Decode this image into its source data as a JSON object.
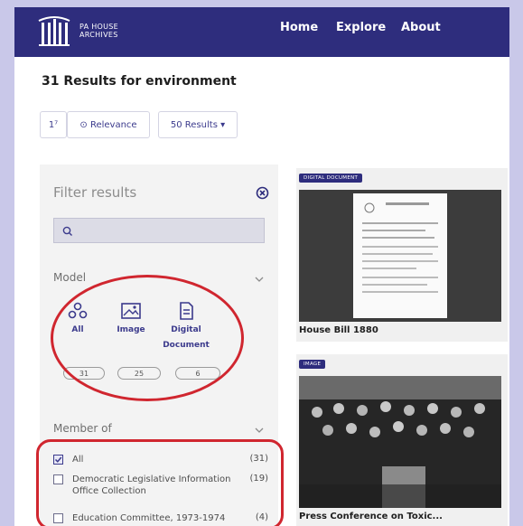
{
  "header": {
    "logo_text_line1": "PA HOUSE",
    "logo_text_line2": "ARCHIVES",
    "nav": [
      "Home",
      "Explore",
      "About"
    ]
  },
  "results": {
    "title": "31 Results for environment"
  },
  "toolbar": {
    "sort_icon_text": "1⁷",
    "sort_label": "⊙ Relevance",
    "per_page_label": "50 Results ▾"
  },
  "filter": {
    "title": "Filter results",
    "search_placeholder": "",
    "model_label": "Model",
    "models": [
      {
        "label": "All",
        "count": "31"
      },
      {
        "label": "Image",
        "count": "25"
      },
      {
        "label": "Digital Document",
        "count": "6"
      }
    ],
    "member_of_label": "Member of",
    "collections": [
      {
        "label": "All",
        "count": "(31)",
        "checked": true
      },
      {
        "label": "Democratic Legislative Information Office Collection",
        "count": "(19)",
        "checked": false
      },
      {
        "label": "Education Committee, 1973-1974",
        "count": "(4)",
        "checked": false
      }
    ]
  },
  "cards": [
    {
      "badge": "DIGITAL DOCUMENT",
      "title": "House Bill 1880"
    },
    {
      "badge": "IMAGE",
      "title": "Press Conference on Toxic..."
    }
  ],
  "colors": {
    "header_bg": "#2e2d7d",
    "accent": "#3b3a8c",
    "annotation": "#d0262f",
    "outer_bg": "#c9c8e9"
  }
}
